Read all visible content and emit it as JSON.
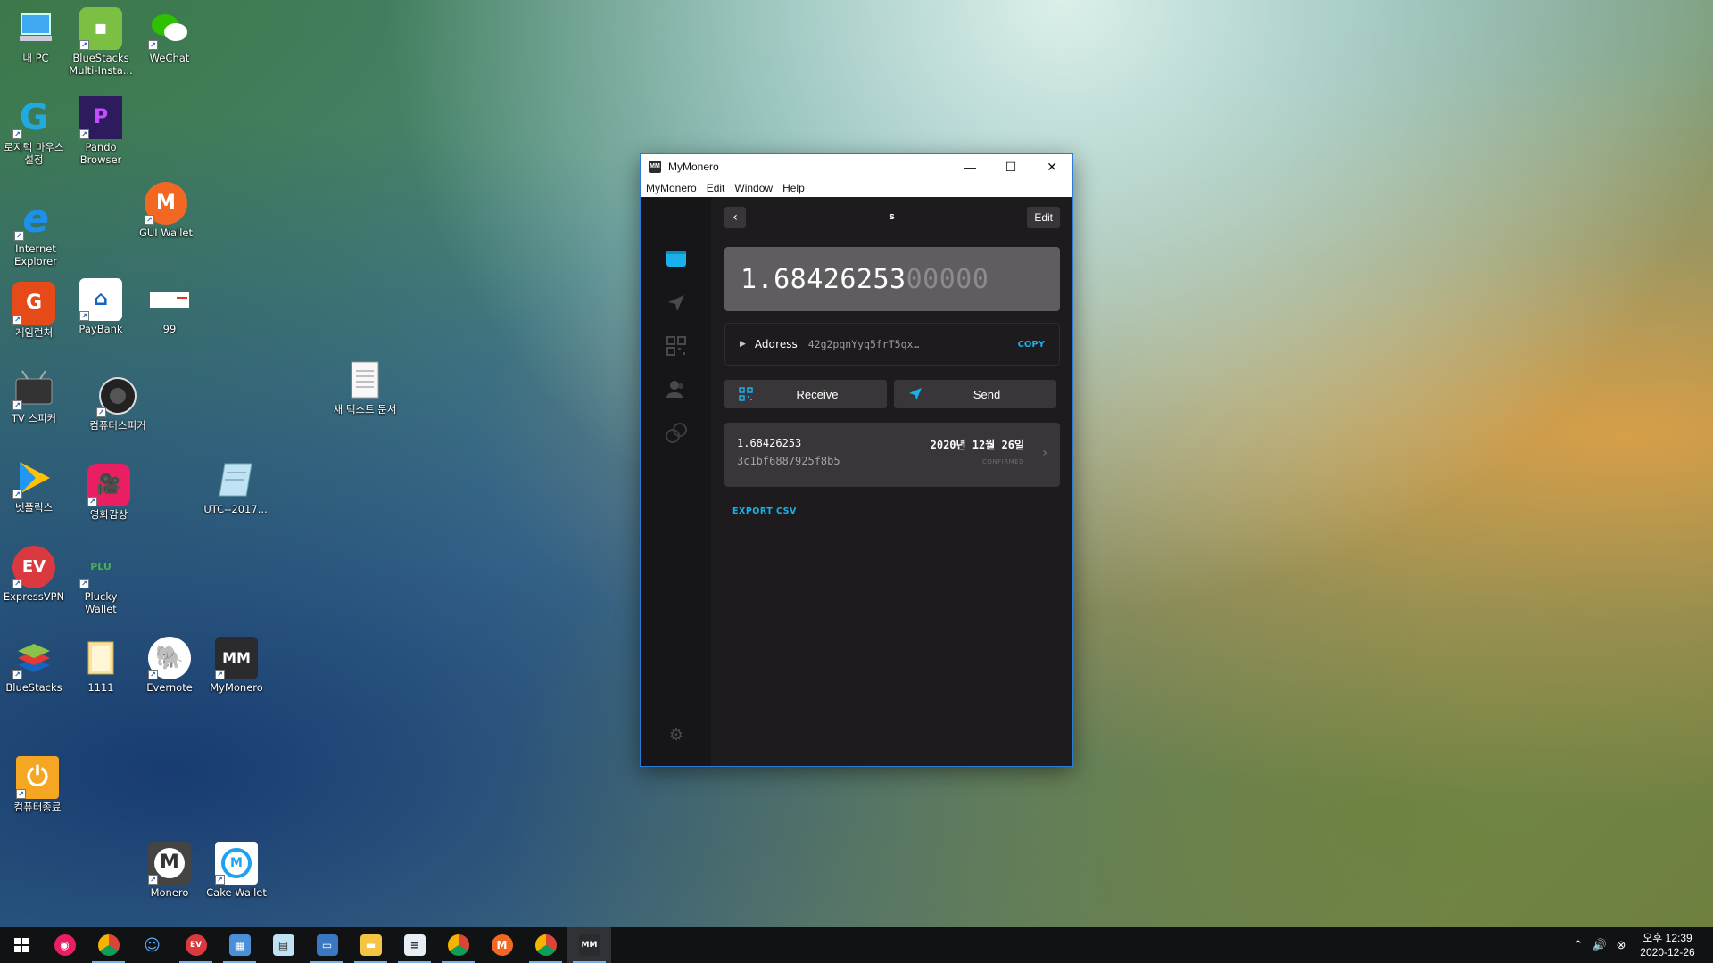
{
  "desktop": {
    "icons": [
      {
        "label": "내 PC",
        "icon": "computer-icon"
      },
      {
        "label": "BlueStacks Multi-Insta...",
        "icon": "bluestacks-multi-icon"
      },
      {
        "label": "WeChat",
        "icon": "wechat-icon"
      },
      {
        "label": "로지텍 마우스설정",
        "icon": "logitech-icon"
      },
      {
        "label": "Pando Browser",
        "icon": "pando-browser-icon"
      },
      {
        "label": "GUI Wallet",
        "icon": "monero-gui-icon"
      },
      {
        "label": "Internet Explorer",
        "icon": "internet-explorer-icon"
      },
      {
        "label": "게임런처",
        "icon": "game-launcher-icon"
      },
      {
        "label": "PayBank",
        "icon": "paybank-icon"
      },
      {
        "label": "99",
        "icon": "image-file-icon"
      },
      {
        "label": "TV 스피커",
        "icon": "tv-speaker-icon"
      },
      {
        "label": "컴퓨터스피커",
        "icon": "speaker-icon"
      },
      {
        "label": "새 텍스트 문서",
        "icon": "text-document-icon"
      },
      {
        "label": "넷플릭스",
        "icon": "netflix-play-icon"
      },
      {
        "label": "영화감상",
        "icon": "movie-icon"
      },
      {
        "label": "UTC--2017...",
        "icon": "notepad-file-icon"
      },
      {
        "label": "ExpressVPN",
        "icon": "expressvpn-icon"
      },
      {
        "label": "Plucky Wallet",
        "icon": "plucky-wallet-icon"
      },
      {
        "label": "BlueStacks",
        "icon": "bluestacks-icon"
      },
      {
        "label": "1111",
        "icon": "folder-icon"
      },
      {
        "label": "Evernote",
        "icon": "evernote-icon"
      },
      {
        "label": "MyMonero",
        "icon": "mymonero-icon"
      },
      {
        "label": "컴퓨터종료",
        "icon": "power-icon"
      },
      {
        "label": "Monero",
        "icon": "monero-icon"
      },
      {
        "label": "Cake Wallet",
        "icon": "cake-wallet-icon"
      }
    ]
  },
  "window": {
    "title": "MyMonero",
    "app_icon_text": "MM",
    "controls": {
      "minimize": "—",
      "maximize": "☐",
      "close": "✕"
    },
    "menu": [
      "MyMonero",
      "Edit",
      "Window",
      "Help"
    ]
  },
  "wallet": {
    "nav_title": "s",
    "back_symbol": "‹",
    "edit_label": "Edit",
    "balance_main": "1.68426253",
    "balance_dim": "00000",
    "address_label": "Address",
    "address_value": "42g2pqnYyq5frT5qx…",
    "copy_label": "COPY",
    "receive_label": "Receive",
    "send_label": "Send",
    "transactions": [
      {
        "amount": "1.68426253",
        "id": "3c1bf6887925f8b5",
        "date": "2020년 12월 26일",
        "status": "CONFIRMED"
      }
    ],
    "export_label": "EXPORT CSV",
    "accent_color": "#18b1e9"
  },
  "taskbar": {
    "items": [
      "start-icon",
      "app-icon",
      "chrome-icon",
      "people-icon",
      "expressvpn-icon",
      "control-panel-icon",
      "notepad-icon",
      "window-icon",
      "file-explorer-icon",
      "document-icon",
      "chrome-icon",
      "monero-icon",
      "chrome-icon",
      "mymonero-icon"
    ],
    "clock_ampm_time": "오후 12:39",
    "clock_date": "2020-12-26"
  }
}
